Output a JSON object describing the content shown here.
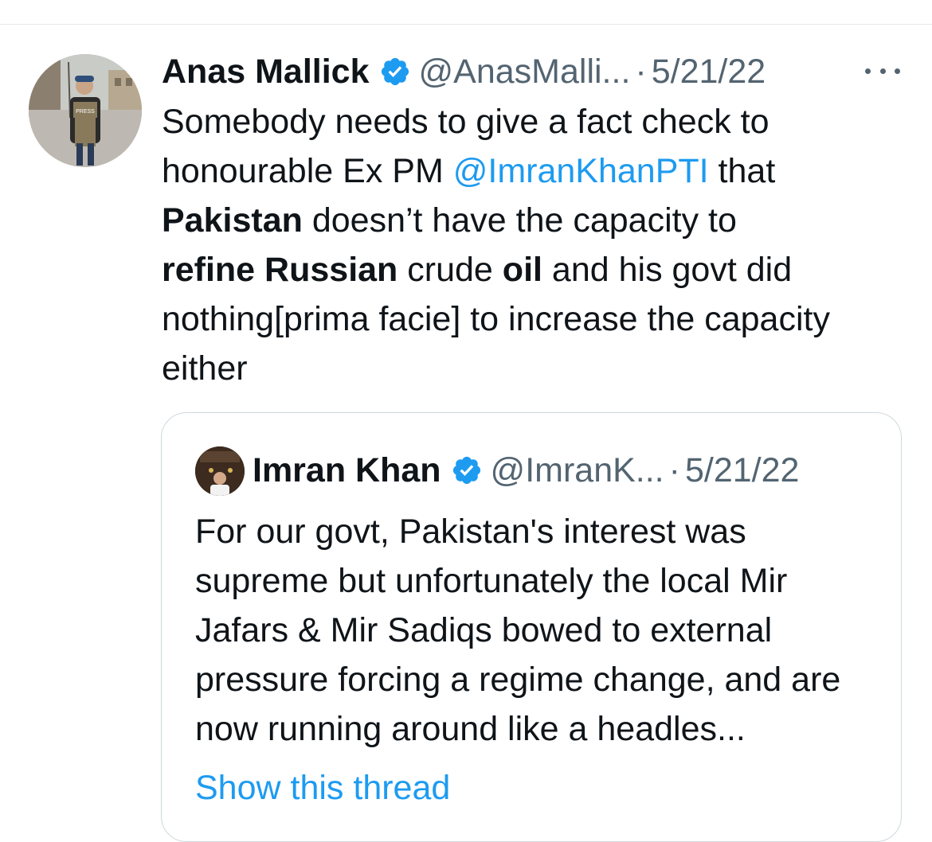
{
  "tweet": {
    "author_name": "Anas Mallick",
    "handle": "@AnasMalli...",
    "separator": "·",
    "date": "5/21/22",
    "text_parts": {
      "p1": "Somebody needs to give a fact check to honourable Ex PM ",
      "mention": "@ImranKhanPTI",
      "p2": " that ",
      "b1": "Pakistan",
      "p3": " doesn’t have the capacity to ",
      "b2": "refine Russian",
      "p4": " crude ",
      "b3": "oil",
      "p5": " and his govt did nothing[prima facie] to increase the capacity either"
    },
    "avatar_badge": "PRESS"
  },
  "quote": {
    "author_name": "Imran Khan",
    "handle": "@ImranK...",
    "separator": "·",
    "date": "5/21/22",
    "text": "For our govt, Pakistan's interest was supreme but unfortunately the local Mir Jafars & Mir Sadiqs bowed to external pressure forcing a regime change, and are now running around like a headles...",
    "show_thread": "Show this thread"
  },
  "colors": {
    "link": "#1d9bf0",
    "muted": "#536471",
    "text": "#0f1419",
    "border": "#cfd9de"
  },
  "icons": [
    "verified-badge-icon",
    "more-options-icon"
  ]
}
